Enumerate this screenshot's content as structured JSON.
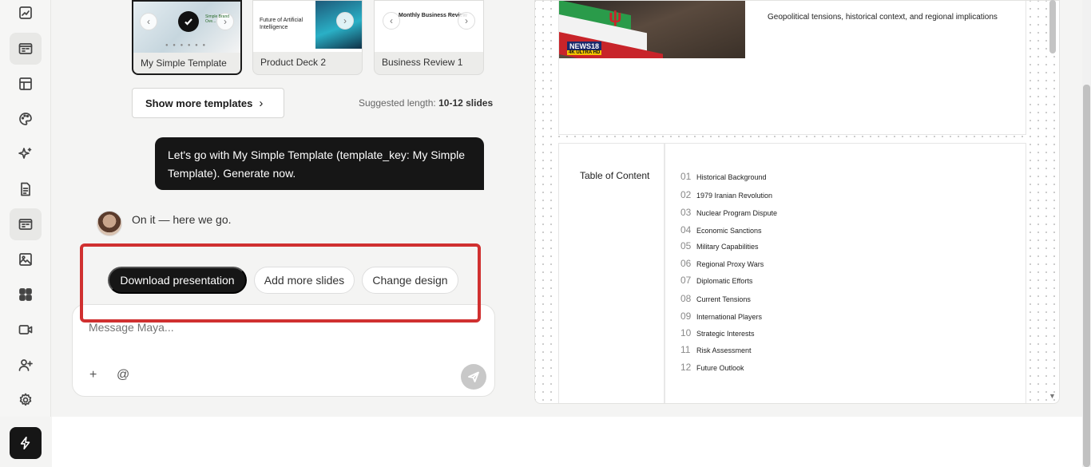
{
  "templates": [
    {
      "label": "My Simple Template",
      "thumb_text": "Simple Brand Ove...",
      "selected": true
    },
    {
      "label": "Product Deck 2",
      "thumb_text": "Future of Artificial Intelligence"
    },
    {
      "label": "Business Review 1",
      "thumb_text": "Monthly Business Review"
    }
  ],
  "show_more_label": "Show more templates",
  "suggest": {
    "prefix": "Suggested length:",
    "value": "10-12 slides"
  },
  "user_message": "Let's go with My Simple Template (template_key: My Simple Template). Generate now.",
  "assistant_message": "On it — here we go.",
  "actions": {
    "download": "Download presentation",
    "add_slides": "Add more slides",
    "change_design": "Change design"
  },
  "composer": {
    "placeholder": "Message Maya..."
  },
  "colors": {
    "accent_dark": "#161616",
    "highlight": "#d03030"
  },
  "preview": {
    "slide1_subtitle": "Geopolitical tensions, historical context, and regional implications",
    "news_logo": "NEWS18",
    "news_sub": "4K ULTRA HD",
    "toc_title": "Table of Content",
    "toc": [
      {
        "num": "01",
        "text": "Historical Background"
      },
      {
        "num": "02",
        "text": "1979 Iranian Revolution"
      },
      {
        "num": "03",
        "text": "Nuclear Program Dispute"
      },
      {
        "num": "04",
        "text": "Economic Sanctions"
      },
      {
        "num": "05",
        "text": "Military Capabilities"
      },
      {
        "num": "06",
        "text": "Regional Proxy Wars"
      },
      {
        "num": "07",
        "text": "Diplomatic Efforts"
      },
      {
        "num": "08",
        "text": "Current Tensions"
      },
      {
        "num": "09",
        "text": "International Players"
      },
      {
        "num": "10",
        "text": "Strategic Interests"
      },
      {
        "num": "11",
        "text": "Risk Assessment"
      },
      {
        "num": "12",
        "text": "Future Outlook"
      }
    ]
  }
}
